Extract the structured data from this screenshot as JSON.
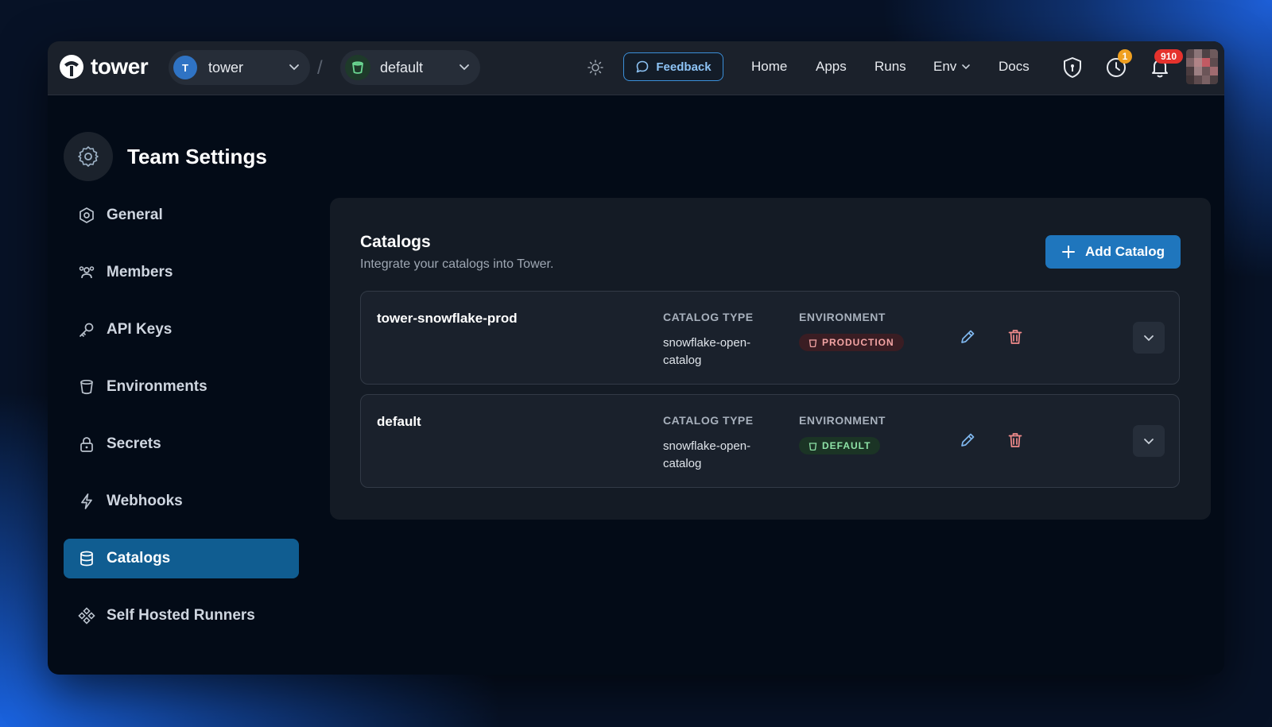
{
  "app": {
    "brand": "tower"
  },
  "topbar": {
    "team": {
      "initial": "T",
      "name": "tower"
    },
    "environment": {
      "name": "default"
    },
    "feedback_label": "Feedback",
    "nav": [
      "Home",
      "Apps",
      "Runs",
      "Env",
      "Docs"
    ],
    "clock_badge": "1",
    "notifications_badge": "910"
  },
  "sidebar": {
    "title": "Team Settings",
    "items": [
      {
        "label": "General",
        "icon": "hexagon-settings-icon"
      },
      {
        "label": "Members",
        "icon": "users-icon"
      },
      {
        "label": "API Keys",
        "icon": "key-icon"
      },
      {
        "label": "Environments",
        "icon": "bucket-icon"
      },
      {
        "label": "Secrets",
        "icon": "lock-icon"
      },
      {
        "label": "Webhooks",
        "icon": "lightning-icon"
      },
      {
        "label": "Catalogs",
        "icon": "database-icon",
        "active": true
      },
      {
        "label": "Self Hosted Runners",
        "icon": "runners-icon"
      }
    ]
  },
  "main": {
    "title": "Catalogs",
    "subtitle": "Integrate your catalogs into Tower.",
    "add_button": "Add Catalog",
    "column_catalog_type": "CATALOG TYPE",
    "column_environment": "ENVIRONMENT",
    "catalogs": [
      {
        "name": "tower-snowflake-prod",
        "type": "snowflake-open-catalog",
        "environment": "PRODUCTION"
      },
      {
        "name": "default",
        "type": "snowflake-open-catalog",
        "environment": "DEFAULT"
      }
    ]
  },
  "colors": {
    "accent": "#1f76bd",
    "active_nav": "#105d91",
    "production_badge": "#3a1d23",
    "default_badge": "#1b3425",
    "notification_badge": "#e5322d",
    "clock_badge": "#f0a020"
  }
}
